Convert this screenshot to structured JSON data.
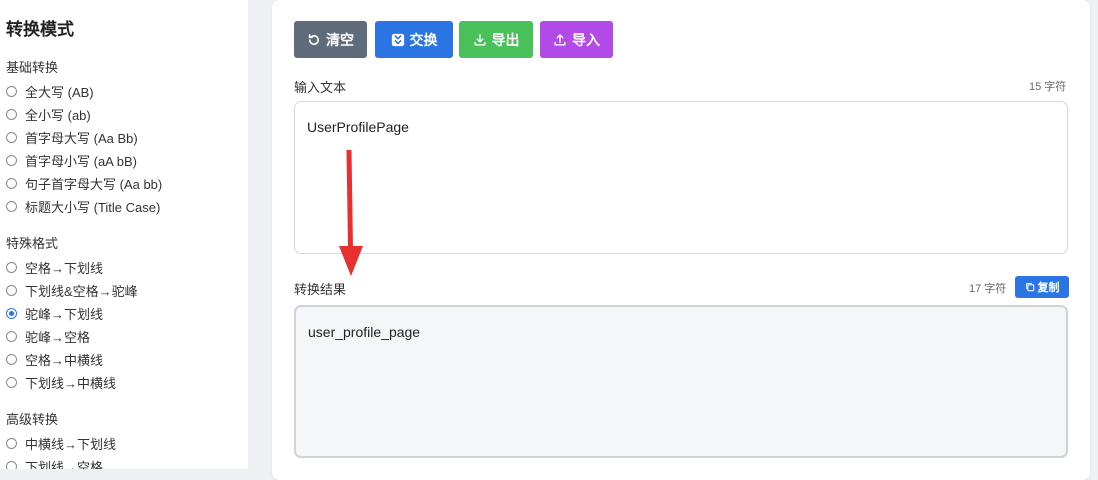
{
  "sidebar": {
    "title": "转换模式",
    "groups": [
      {
        "title": "基础转换",
        "options": [
          "全大写 (AB)",
          "全小写 (ab)",
          "首字母大写 (Aa Bb)",
          "首字母小写 (aA bB)",
          "句子首字母大写 (Aa bb)",
          "标题大小写 (Title Case)"
        ]
      },
      {
        "title": "特殊格式",
        "options": [
          "空格→下划线",
          "下划线&空格→驼峰",
          "驼峰→下划线",
          "驼峰→空格",
          "空格→中横线",
          "下划线→中横线"
        ]
      },
      {
        "title": "高级转换",
        "options": [
          "中横线→下划线",
          "下划线→空格"
        ]
      }
    ],
    "selected": "驼峰→下划线"
  },
  "toolbar": {
    "clear_label": "清空",
    "swap_label": "交换",
    "export_label": "导出",
    "import_label": "导入"
  },
  "colors": {
    "clear": "#5f6b7a",
    "swap": "#2b74e4",
    "export": "#49c05a",
    "import": "#b24ae8",
    "arrow": "#e8312f"
  },
  "input": {
    "label": "输入文本",
    "count": "15 字符",
    "value": "UserProfilePage"
  },
  "output": {
    "label": "转换结果",
    "count": "17 字符",
    "copy_label": "复制",
    "value": "user_profile_page"
  }
}
